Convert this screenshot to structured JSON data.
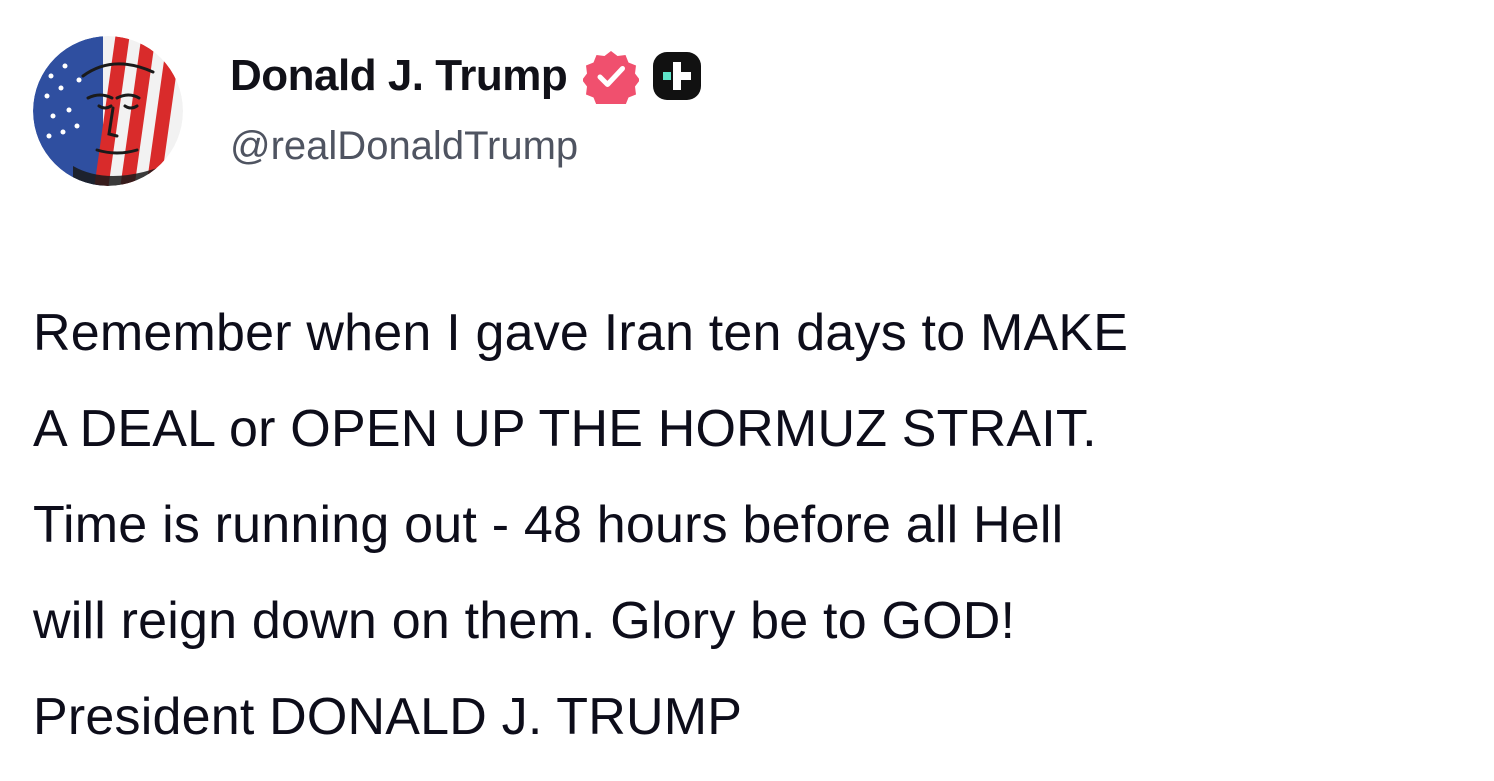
{
  "post": {
    "author": {
      "display_name": "Donald J. Trump",
      "handle": "@realDonaldTrump",
      "avatar_icon": "flag-portrait-avatar",
      "verified_icon": "verified-check-icon",
      "plus_icon": "plus-badge-icon"
    },
    "body_lines": [
      "Remember when I gave Iran ten days to MAKE",
      "A DEAL or OPEN UP THE HORMUZ STRAIT.",
      "Time is running out - 48 hours before all Hell",
      "will reign down on them. Glory be to GOD!",
      "President DONALD J. TRUMP"
    ]
  },
  "colors": {
    "text": "#0d0d1a",
    "handle": "#4f5461",
    "verified": "#f0506e",
    "plus_badge_bg": "#111111",
    "plus_badge_accent": "#5fe3c9"
  }
}
